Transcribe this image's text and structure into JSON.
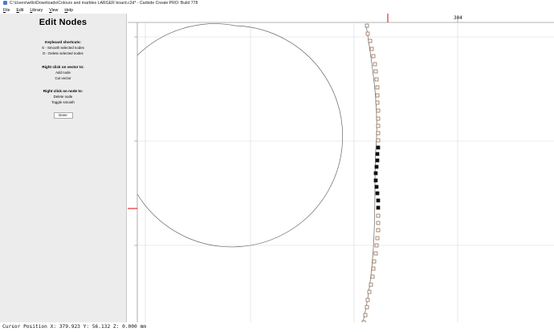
{
  "window": {
    "title": "C:\\Users\\willo\\Downloads\\Colours and marbles LARGER board.c2d* - Carbide Create PRO: Build 778"
  },
  "menu": {
    "items": [
      "File",
      "Edit",
      "Library",
      "View",
      "Help"
    ]
  },
  "left_panel": {
    "title": "Edit Nodes",
    "sections": [
      {
        "heading": "Keyboard shortcuts:",
        "lines": [
          "S - Smooth selected nodes",
          "D - Delete selected nodes"
        ]
      },
      {
        "heading": "Right click on vector to:",
        "lines": [
          "Add node",
          "Cut vector"
        ]
      },
      {
        "heading": "Right click on node to:",
        "lines": [
          "Delete node",
          "Toggle smooth"
        ]
      }
    ],
    "done_label": "Done"
  },
  "ruler": {
    "top_label": "304"
  },
  "colors": {
    "ruler_marker": "#e03030",
    "node_outline": "#8a5a3c",
    "node_selected": "#111111",
    "grid": "#d8d8d8",
    "vector": "#666666"
  },
  "status": {
    "cursor_label": "Cursor Position",
    "x": "379.923",
    "y": "56.132",
    "z": "0.000",
    "units": "mm"
  }
}
